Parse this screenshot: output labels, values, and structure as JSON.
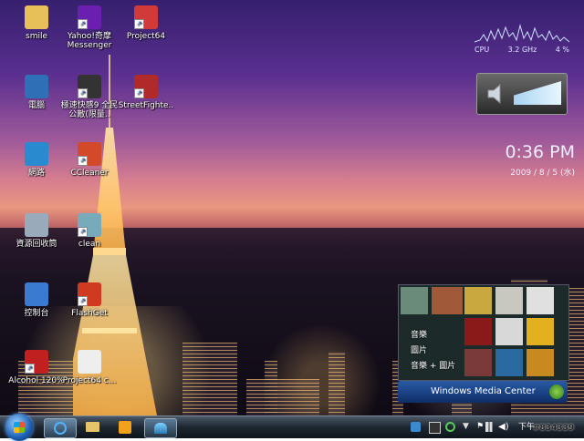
{
  "desktop_icons": [
    {
      "label": "smile",
      "icon": "folder-icon",
      "shortcut": false
    },
    {
      "label": "Yahoo!奇摩\nMessenger",
      "icon": "yahoo-messenger-icon",
      "shortcut": true
    },
    {
      "label": "Project64",
      "icon": "project64-icon",
      "shortcut": true
    },
    {
      "label": "電腦",
      "icon": "computer-icon",
      "shortcut": false
    },
    {
      "label": "極速快感9 全民公敵(限量..",
      "icon": "nfs-icon",
      "shortcut": true
    },
    {
      "label": "StreetFighte..",
      "icon": "streetfighter-icon",
      "shortcut": true
    },
    {
      "label": "網路",
      "icon": "network-icon",
      "shortcut": false
    },
    {
      "label": "CCleaner",
      "icon": "ccleaner-icon",
      "shortcut": true
    },
    {
      "label": "資源回收筒",
      "icon": "recycle-bin-icon",
      "shortcut": false
    },
    {
      "label": "clean",
      "icon": "clean-icon",
      "shortcut": true
    },
    {
      "label": "控制台",
      "icon": "control-panel-icon",
      "shortcut": false
    },
    {
      "label": "FlashGet",
      "icon": "flashget-icon",
      "shortcut": true
    },
    {
      "label": "Alcohol 120%",
      "icon": "alcohol-icon",
      "shortcut": true
    },
    {
      "label": "Project64 c...",
      "icon": "document-icon",
      "shortcut": false
    }
  ],
  "cpu_gadget": {
    "cpu_label": "CPU",
    "ghz": "3.2",
    "ghz_unit": "GHz",
    "usage": "4 %"
  },
  "clock_gadget": {
    "time": "0:36 PM",
    "date": "2009 / 8 / 5 (水)"
  },
  "media_center": {
    "menu": [
      "音樂",
      "圖片",
      "音樂 + 圖片"
    ],
    "brand": "Windows Media Center"
  },
  "taskbar": {
    "start_icon": "windows-orb-icon",
    "pinned": [
      "ie-icon",
      "explorer-icon",
      "media-player-icon",
      "network-app-icon"
    ],
    "tray_time": "下午",
    "watermark": "#834339"
  },
  "colors": {
    "taskbar": "#1d2630",
    "wmc_bar": "#1e4a8f"
  }
}
